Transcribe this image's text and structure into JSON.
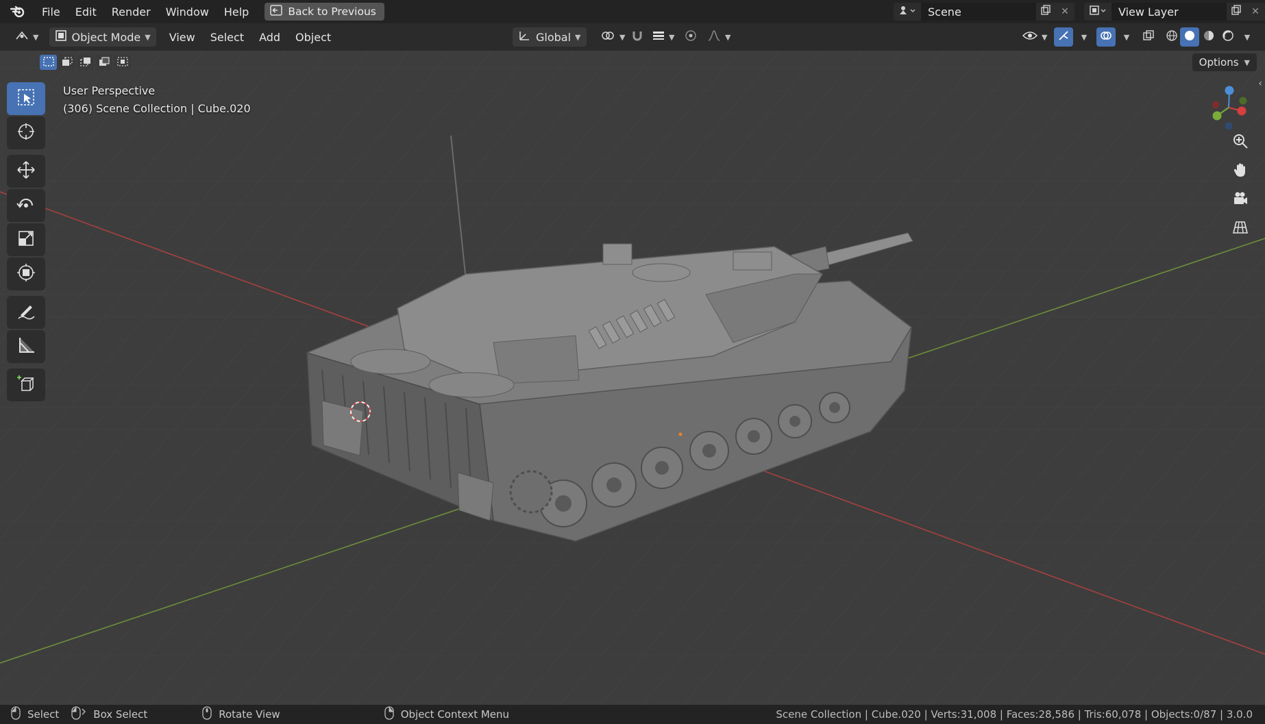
{
  "menu": [
    "File",
    "Edit",
    "Render",
    "Window",
    "Help"
  ],
  "back_button": "Back to Previous",
  "scene": {
    "value": "Scene"
  },
  "view_layer": {
    "value": "View Layer"
  },
  "header": {
    "mode": "Object Mode",
    "items": [
      "View",
      "Select",
      "Add",
      "Object"
    ],
    "orientation": "Global"
  },
  "options_label": "Options",
  "viewport": {
    "perspective": "User Perspective",
    "collection_info": "(306) Scene Collection | Cube.020"
  },
  "status": {
    "items": [
      "Select",
      "Box Select",
      "Rotate View",
      "Object Context Menu"
    ],
    "stats": "Scene Collection | Cube.020 | Verts:31,008 | Faces:28,586 | Tris:60,078 | Objects:0/87 | 3.0.0"
  },
  "colors": {
    "accent": "#4772b3",
    "x_axis": "#d43f3f",
    "y_axis": "#7bac3a",
    "z_axis": "#4c8fd8",
    "viewport_bg": "#3d3d3d",
    "topbar_bg": "#232323"
  },
  "icons": {
    "logo": "blender-logo-icon",
    "tools": [
      "select-box-icon",
      "cursor-icon",
      "move-icon",
      "rotate-icon",
      "scale-icon",
      "transform-icon",
      "annotate-icon",
      "measure-icon",
      "add-cube-icon"
    ],
    "nav": [
      "zoom-icon",
      "hand-pan-icon",
      "camera-icon",
      "grid-ortho-icon"
    ]
  }
}
